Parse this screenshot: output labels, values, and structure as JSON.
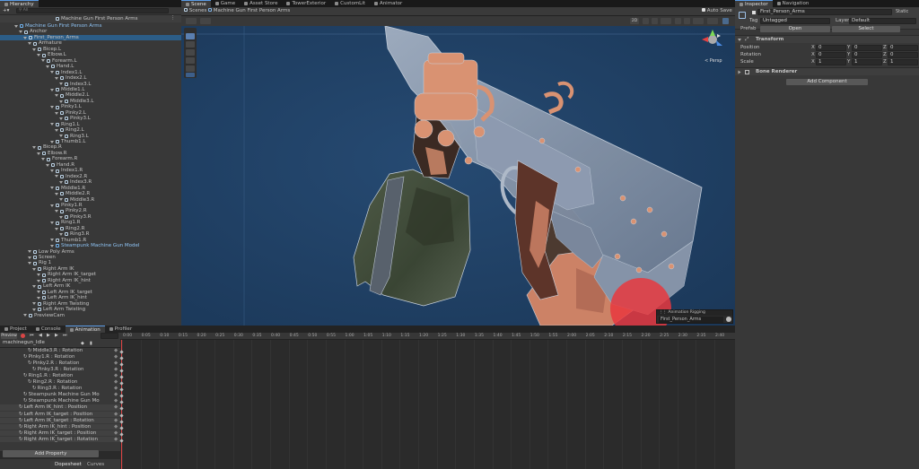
{
  "hierarchy": {
    "tab": "Hierarchy",
    "search_placeholder": "All",
    "scene_title": "Machine Gun First Person Arms",
    "rows": [
      {
        "label": "Machine Gun First Person Arms",
        "depth": 1,
        "prefab": true
      },
      {
        "label": "Anchor",
        "depth": 2
      },
      {
        "label": "First_Person_Arms",
        "depth": 3,
        "selected": true
      },
      {
        "label": "Armature",
        "depth": 4
      },
      {
        "label": "Bicep.L",
        "depth": 5
      },
      {
        "label": "Elbow.L",
        "depth": 6
      },
      {
        "label": "Forearm.L",
        "depth": 7
      },
      {
        "label": "Hand.L",
        "depth": 8
      },
      {
        "label": "Index1.L",
        "depth": 9
      },
      {
        "label": "Index2.L",
        "depth": 10
      },
      {
        "label": "Index3.L",
        "depth": 11
      },
      {
        "label": "Middle1.L",
        "depth": 9
      },
      {
        "label": "Middle2.L",
        "depth": 10
      },
      {
        "label": "Middle3.L",
        "depth": 11
      },
      {
        "label": "Pinky1.L",
        "depth": 9
      },
      {
        "label": "Pinky2.L",
        "depth": 10
      },
      {
        "label": "Pinky3.L",
        "depth": 11
      },
      {
        "label": "Ring1.L",
        "depth": 9
      },
      {
        "label": "Ring2.L",
        "depth": 10
      },
      {
        "label": "Ring3.L",
        "depth": 11
      },
      {
        "label": "Thumb1.L",
        "depth": 9
      },
      {
        "label": "Bicep.R",
        "depth": 5
      },
      {
        "label": "Elbow.R",
        "depth": 6
      },
      {
        "label": "Forearm.R",
        "depth": 7
      },
      {
        "label": "Hand.R",
        "depth": 8
      },
      {
        "label": "Index1.R",
        "depth": 9
      },
      {
        "label": "Index2.R",
        "depth": 10
      },
      {
        "label": "Index3.R",
        "depth": 11
      },
      {
        "label": "Middle1.R",
        "depth": 9
      },
      {
        "label": "Middle2.R",
        "depth": 10
      },
      {
        "label": "Middle3.R",
        "depth": 11
      },
      {
        "label": "Pinky1.R",
        "depth": 9
      },
      {
        "label": "Pinky2.R",
        "depth": 10
      },
      {
        "label": "Pinky3.R",
        "depth": 11
      },
      {
        "label": "Ring1.R",
        "depth": 9
      },
      {
        "label": "Ring2.R",
        "depth": 10
      },
      {
        "label": "Ring3.R",
        "depth": 11
      },
      {
        "label": "Thumb1.R",
        "depth": 9
      },
      {
        "label": "Steampunk Machine Gun Model",
        "depth": 9,
        "prefab": true
      },
      {
        "label": "Low Poly Arms",
        "depth": 4
      },
      {
        "label": "Screen",
        "depth": 4
      },
      {
        "label": "Rig 1",
        "depth": 4
      },
      {
        "label": "Right Arm IK",
        "depth": 5
      },
      {
        "label": "Right Arm IK_target",
        "depth": 6
      },
      {
        "label": "Right Arm IK_hint",
        "depth": 6
      },
      {
        "label": "Left Arm IK",
        "depth": 5
      },
      {
        "label": "Left Arm IK_target",
        "depth": 6
      },
      {
        "label": "Left Arm IK_hint",
        "depth": 6
      },
      {
        "label": "Right Arm Twisting",
        "depth": 5
      },
      {
        "label": "Left Arm Twisting",
        "depth": 5
      },
      {
        "label": "PreviewCam",
        "depth": 3
      }
    ]
  },
  "center_tabs": [
    "Scene",
    "Game",
    "Asset Store",
    "TowerExterior",
    "CustomLit",
    "Animator"
  ],
  "scene": {
    "breadcrumb_root": "Scenes",
    "breadcrumb_current": "Machine Gun First Person Arms",
    "auto_save_label": "Auto Save",
    "mode_2d": "2D",
    "gizmo_label": "< Persp",
    "overlay_title": "Animation Rigging",
    "overlay_value": "First_Person_Arms"
  },
  "bottom_tabs": [
    "Project",
    "Console",
    "Animation",
    "Profiler"
  ],
  "animation": {
    "preview_label": "Preview",
    "clip_name": "machinegun_Idle",
    "add_property_label": "Add Property",
    "dopesheet_tab": "Dopesheet",
    "curves_tab": "Curves",
    "ruler_ticks": [
      "0:00",
      "0:05",
      "0:10",
      "0:15",
      "0:20",
      "0:25",
      "0:30",
      "0:35",
      "0:40",
      "0:45",
      "0:50",
      "0:55",
      "1:00",
      "1:05",
      "1:10",
      "1:15",
      "1:20",
      "1:25",
      "1:30",
      "1:35",
      "1:40",
      "1:45",
      "1:50",
      "1:55",
      "2:00",
      "2:05",
      "2:10",
      "2:15",
      "2:20",
      "2:25",
      "2:30",
      "2:35",
      "2:40"
    ],
    "properties": [
      {
        "label": "Middle3.R : Rotation",
        "indent": 2
      },
      {
        "label": "Pinky1.R : Rotation",
        "indent": 1
      },
      {
        "label": "Pinky2.R : Rotation",
        "indent": 2
      },
      {
        "label": "Pinky3.R : Rotation",
        "indent": 3
      },
      {
        "label": "Ring1.R : Rotation",
        "indent": 1
      },
      {
        "label": "Ring2.R : Rotation",
        "indent": 2
      },
      {
        "label": "Ring3.R : Rotation",
        "indent": 3
      },
      {
        "label": "Steampunk Machine Gun Mo",
        "indent": 1
      },
      {
        "label": "Steampunk Machine Gun Mo",
        "indent": 1
      },
      {
        "label": "Left Arm IK_hint : Position",
        "indent": 0
      },
      {
        "label": "Left Arm IK_target : Position",
        "indent": 0
      },
      {
        "label": "Left Arm IK_target : Rotation",
        "indent": 0
      },
      {
        "label": "Right Arm IK_hint : Position",
        "indent": 0
      },
      {
        "label": "Right Arm IK_target : Position",
        "indent": 0
      },
      {
        "label": "Right Arm IK_target : Rotation",
        "indent": 0
      }
    ]
  },
  "inspector": {
    "tabs": [
      "Inspector",
      "Navigation"
    ],
    "object_name": "First_Person_Arms",
    "static_label": "Static",
    "tag_label": "Tag",
    "tag_value": "Untagged",
    "layer_label": "Layer",
    "layer_value": "Default",
    "prefab_label": "Prefab",
    "open_label": "Open",
    "select_label": "Select",
    "transform_title": "Transform",
    "position_label": "Position",
    "rotation_label": "Rotation",
    "scale_label": "Scale",
    "x": "X",
    "y": "Y",
    "z": "Z",
    "position": [
      "0",
      "0",
      "0"
    ],
    "rotation": [
      "0",
      "0",
      "0"
    ],
    "scale": [
      "1",
      "1",
      "1"
    ],
    "bone_renderer": "Bone Renderer",
    "add_component": "Add Component"
  },
  "colors": {
    "accent": "#3a5a86",
    "scene_bg": "#1f3e62",
    "selection": "#2c5d87",
    "gun": "#8796ab",
    "copper": "#d99272",
    "red_marker": "#e8383e"
  }
}
